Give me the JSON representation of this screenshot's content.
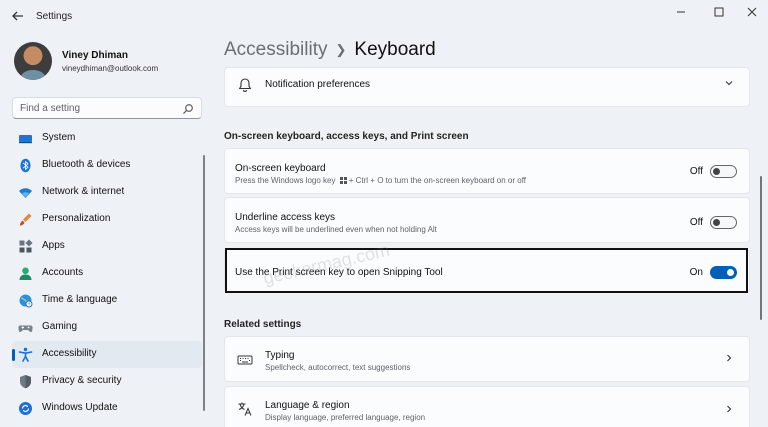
{
  "window": {
    "title": "Settings",
    "back_icon": "arrow-left-icon",
    "minimize_icon": "minimize-icon",
    "maximize_icon": "maximize-icon",
    "close_icon": "close-icon"
  },
  "profile": {
    "name": "Viney Dhiman",
    "email": "vineydhiman@outlook.com"
  },
  "search": {
    "placeholder": "Find a setting",
    "value": ""
  },
  "sidebar": {
    "items": [
      {
        "label": "System",
        "icon": "system-icon",
        "active": false
      },
      {
        "label": "Bluetooth & devices",
        "icon": "bluetooth-icon",
        "active": false
      },
      {
        "label": "Network & internet",
        "icon": "network-icon",
        "active": false
      },
      {
        "label": "Personalization",
        "icon": "brush-icon",
        "active": false
      },
      {
        "label": "Apps",
        "icon": "apps-icon",
        "active": false
      },
      {
        "label": "Accounts",
        "icon": "accounts-icon",
        "active": false
      },
      {
        "label": "Time & language",
        "icon": "globe-icon",
        "active": false
      },
      {
        "label": "Gaming",
        "icon": "gaming-icon",
        "active": false
      },
      {
        "label": "Accessibility",
        "icon": "accessibility-icon",
        "active": true
      },
      {
        "label": "Privacy & security",
        "icon": "shield-icon",
        "active": false
      },
      {
        "label": "Windows Update",
        "icon": "update-icon",
        "active": false
      }
    ]
  },
  "breadcrumb": {
    "parent": "Accessibility",
    "current": "Keyboard"
  },
  "main": {
    "notification": {
      "title": "Notification preferences",
      "icon": "bell-icon"
    },
    "section_onscreen": "On-screen keyboard, access keys, and Print screen",
    "onscreen_keyboard": {
      "title": "On-screen keyboard",
      "desc_before": "Press the Windows logo key",
      "desc_after": "+ Ctrl + O to turn the on-screen keyboard on or off",
      "state": "Off",
      "on": false
    },
    "underline_keys": {
      "title": "Underline access keys",
      "desc": "Access keys will be underlined even when not holding Alt",
      "state": "Off",
      "on": false
    },
    "print_screen": {
      "title": "Use the Print screen key to open Snipping Tool",
      "state": "On",
      "on": true
    },
    "section_related": "Related settings",
    "typing": {
      "title": "Typing",
      "desc": "Spellcheck, autocorrect, text suggestions",
      "icon": "keyboard-icon"
    },
    "language": {
      "title": "Language & region",
      "desc": "Display language, preferred language, region",
      "icon": "language-icon"
    }
  },
  "watermark": "geekermag.com",
  "colors": {
    "accent": "#005fb8",
    "background": "#eef2f6",
    "card": "#fbfcfd"
  }
}
